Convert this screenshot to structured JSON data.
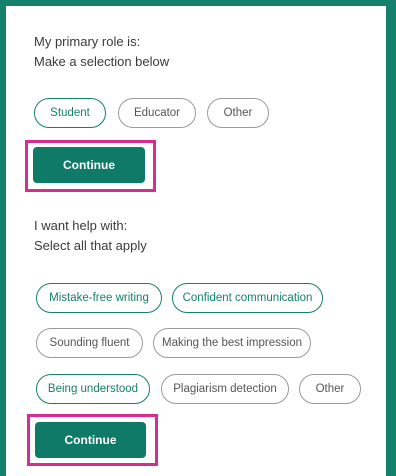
{
  "role_section": {
    "title": "My primary role is:",
    "subtitle": "Make a selection below",
    "options": [
      {
        "label": "Student",
        "selected": true
      },
      {
        "label": "Educator",
        "selected": false
      },
      {
        "label": "Other",
        "selected": false
      }
    ],
    "continue_label": "Continue"
  },
  "help_section": {
    "title": "I want help with:",
    "subtitle": "Select all that apply",
    "options": [
      {
        "label": "Mistake-free writing",
        "selected": true
      },
      {
        "label": "Confident communication",
        "selected": true
      },
      {
        "label": "Sounding fluent",
        "selected": false
      },
      {
        "label": "Making the best impression",
        "selected": false
      },
      {
        "label": "Being understood",
        "selected": true
      },
      {
        "label": "Plagiarism detection",
        "selected": false
      },
      {
        "label": "Other",
        "selected": false
      }
    ],
    "continue_label": "Continue"
  },
  "colors": {
    "accent": "#15806b",
    "button": "#0f7a67",
    "highlight": "#d62d8f"
  }
}
